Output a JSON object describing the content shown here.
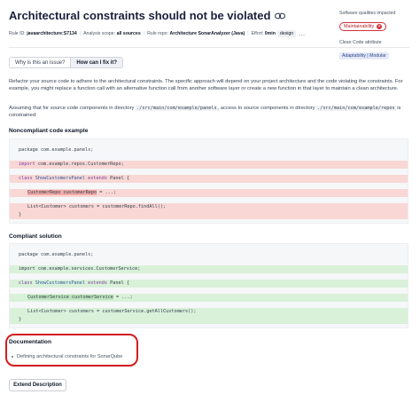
{
  "rule": {
    "title": "Architectural constraints should not be violated",
    "meta": [
      {
        "label": "Rule ID:",
        "value": "javaarchitecture:S7134"
      },
      {
        "label": "Analysis scope:",
        "value": "all sources"
      },
      {
        "label": "Rule repo:",
        "value": "Architecture SonarAnalyzer (Java)"
      },
      {
        "label": "Effort:",
        "value": "0min"
      }
    ],
    "tag": "design",
    "more": "…"
  },
  "sidebar": {
    "qualities_label": "Software qualities impacted",
    "maintainability_badge": "Maintainability",
    "attribute_label": "Clean Code attribute",
    "attribute_value": "Adaptability | Modular"
  },
  "tabs": [
    {
      "label": "Why is this an issue?",
      "active": false
    },
    {
      "label": "How can I fix it?",
      "active": true
    }
  ],
  "description": {
    "paragraph1": "Refactor your source code to adhere to the architectural constraints. The specific approach will depend on your project architecture and the code violating the constraints. For example, you might replace a function call with an alternative function call from another software layer or create a new function in that layer to maintain a clean architecture.",
    "p2_prefix": "Assuming that for source code components in directory",
    "p2_path1": "./src/main/com/example/panels",
    "p2_middle": ", access to source components in directory",
    "p2_path2": "./src/main/com/example/repos",
    "p2_suffix": "is constrained:"
  },
  "noncompliant": {
    "title": "Noncompliant code example",
    "lines": {
      "pkg": "package com.example.panels;",
      "import_kw": "import",
      "import_rest": " com.example.repos.CustomerRepo;",
      "class_kw": "class",
      "class_name": "ShowCustomersPanel",
      "extends_kw": "extends",
      "extends_rest": " Panel {",
      "field": "CustomerRepo customerRepo",
      "field_rest": " = ...;",
      "call": "List<Customer> customers = customerRepo.findAll();",
      "close": "}"
    }
  },
  "compliant": {
    "title": "Compliant solution",
    "lines": {
      "pkg": "package com.example.panels;",
      "import": "import com.example.services.CustomerService;",
      "class_kw": "class",
      "class_name": "ShowCustomersPanel",
      "extends_kw": "extends",
      "extends_rest": " Panel {",
      "field": "CustomerService customerService",
      "field_rest": " = ...;",
      "call": "List<Customer> customers = customerService.getAllCustomers();",
      "close": "}"
    }
  },
  "documentation": {
    "title": "Documentation",
    "item": "Defining architectural constraints for SonarQube"
  },
  "extend_button": "Extend Description"
}
